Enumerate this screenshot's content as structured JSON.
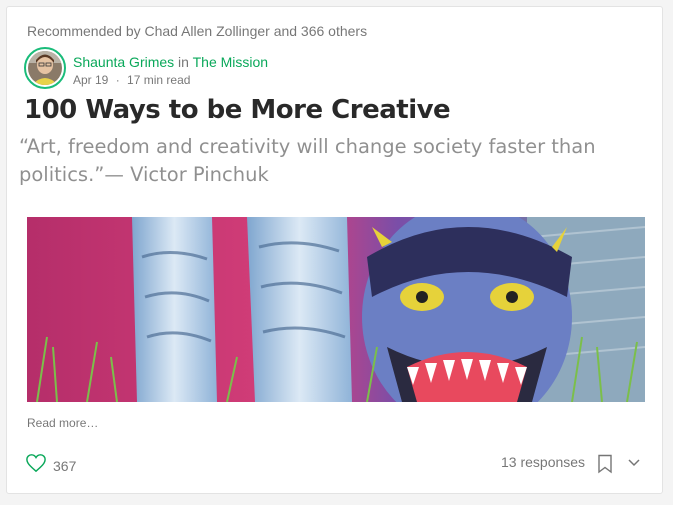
{
  "card": {
    "recommended_text": "Recommended by Chad Allen Zollinger and 366 others",
    "author_name": "Shaunta Grimes",
    "in_text": " in ",
    "publication": "The Mission",
    "date": "Apr 19",
    "separator": "·",
    "read_time": "17 min read",
    "title": "100 Ways to be More Creative",
    "subtitle": "“Art, freedom and creativity will change society faster than politics.”— Victor Pinchuk",
    "read_more": "Read more…",
    "clap_count": "367",
    "responses": "13 responses"
  },
  "colors": {
    "accent_green": "#0aa85a",
    "avatar_ring": "#1abc7a"
  },
  "icons": {
    "clap": "heart-icon",
    "bookmark": "bookmark-icon",
    "more": "chevron-down-icon"
  }
}
